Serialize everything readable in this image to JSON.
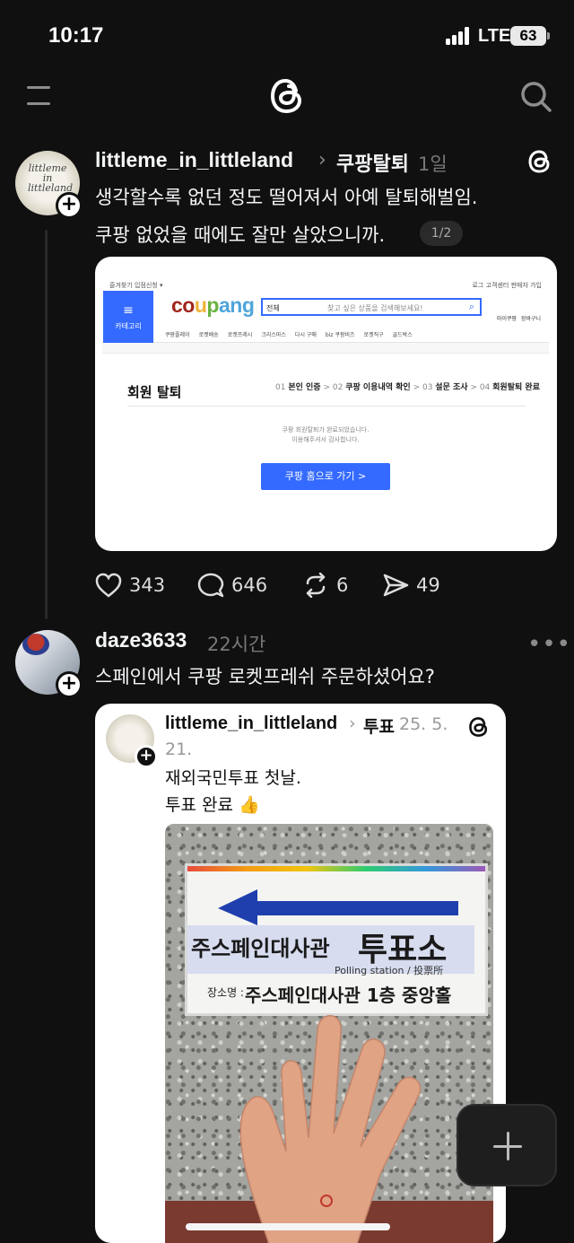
{
  "status_bar": {
    "time": "10:17",
    "network": "LTE",
    "battery": "63"
  },
  "post1": {
    "username": "littleme_in_littleland",
    "topic": "쿠팡탈퇴",
    "time": "1일",
    "text_line1": "생각할수록 없던 정도 떨어져서 아예 탈퇴해벌임.",
    "text_line2": "쿠팡 없었을 때에도 잘만 살았으니까.",
    "page_indicator": "1/2",
    "avatar_text": "littleme in littleland",
    "screenshot": {
      "logo": "coupang",
      "category": "카테고리",
      "search_placeholder": "찾고 싶은 상품을 검색해보세요!",
      "search_select": "전체",
      "topbar_left": "즐겨찾기  입점신청 ▾",
      "topbar_right": "로그  고객센터  판매자 가입",
      "header_icons": [
        "마이쿠팡",
        "장바구니"
      ],
      "nav_items": [
        "쿠팡플레이",
        "로켓배송",
        "로켓프레시",
        "크리스마스",
        "다시 구매",
        "biz 쿠팡비즈",
        "로켓직구",
        "골드박스"
      ],
      "title": "회원 탈퇴",
      "steps": [
        {
          "no": "01",
          "label": "본인 인증"
        },
        {
          "no": "02",
          "label": "쿠팡 이용내역 확인"
        },
        {
          "no": "03",
          "label": "설문 조사"
        },
        {
          "no": "04",
          "label": "회원탈퇴 완료"
        }
      ],
      "msg1": "쿠팡 회원탈퇴가 완료되었습니다.",
      "msg2": "이용해주셔서 감사합니다.",
      "button": "쿠팡 홈으로 가기 >"
    },
    "likes": "343",
    "comments": "646",
    "reposts": "6",
    "shares": "49"
  },
  "post2": {
    "username": "daze3633",
    "time": "22시간",
    "text": "스페인에서 쿠팡 로켓프레쉬 주문하셨어요?",
    "quote": {
      "username": "littleme_in_littleland",
      "topic": "투표",
      "date_part1": "25. 5.",
      "date_part2": "21.",
      "text_line1": "재외국민투표 첫날.",
      "text_line2": "투표 완료 👍",
      "sign_main": "주스페인대사관",
      "sign_big": "투표소",
      "sign_sub": "Polling station / 投票所",
      "sign_loc_label": "장소명 :",
      "sign_loc": "주스페인대사관 1층 중앙홀"
    }
  },
  "colors": {
    "background": "#101010",
    "coupang_blue": "#346aff"
  }
}
